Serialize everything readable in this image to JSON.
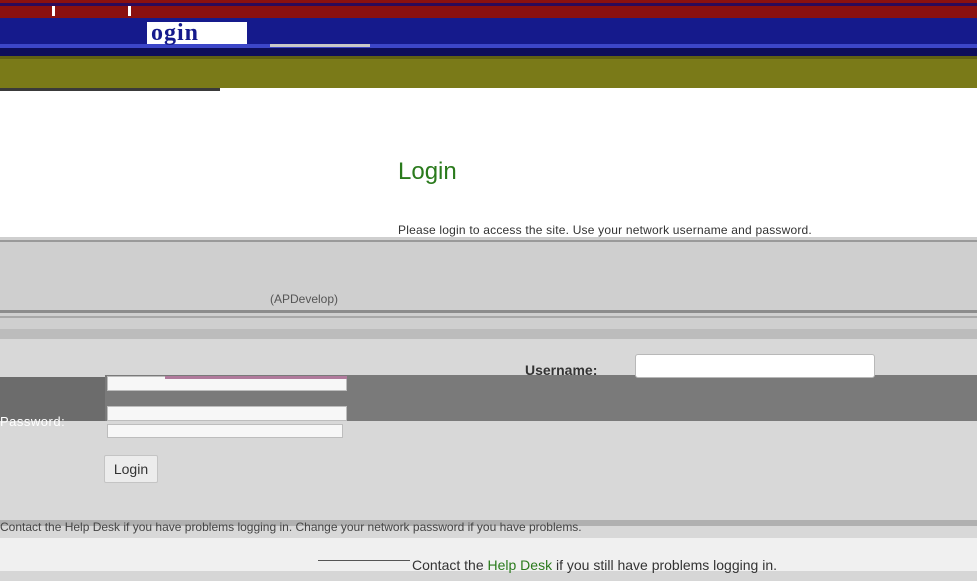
{
  "header": {
    "logo_text": "ogin"
  },
  "main": {
    "title": "Login",
    "intro": "Please login to access the site. Use your network username and password.",
    "hint": "(APDevelop)"
  },
  "form": {
    "username_label": "Username:",
    "username_value": "",
    "password_label": "Password:",
    "password_value": "",
    "submit_label": "Login"
  },
  "notes": {
    "trouble": "Contact the Help Desk if you have problems logging in. Change your network password if you have problems."
  },
  "footer": {
    "prefix": "Contact the ",
    "link": "Help Desk",
    "suffix": " if you still have problems logging in."
  },
  "colors": {
    "brand_red": "#8a1010",
    "brand_navy": "#151a8c",
    "brand_olive": "#7a7a18",
    "title_green": "#2a7a1c"
  }
}
